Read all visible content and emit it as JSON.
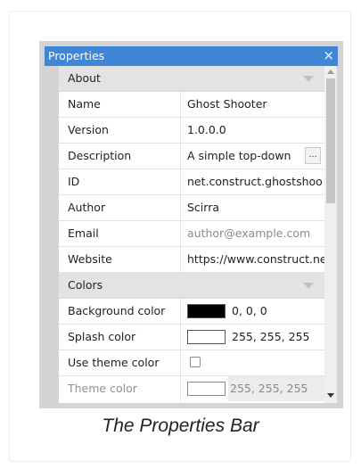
{
  "panel": {
    "title": "Properties",
    "close_icon": "×"
  },
  "sections": {
    "about": "About",
    "colors": "Colors"
  },
  "rows": {
    "name": {
      "label": "Name",
      "value": "Ghost Shooter"
    },
    "version": {
      "label": "Version",
      "value": "1.0.0.0"
    },
    "description": {
      "label": "Description",
      "value": "A simple top-down",
      "button": "..."
    },
    "id": {
      "label": "ID",
      "value": "net.construct.ghostshoo"
    },
    "author": {
      "label": "Author",
      "value": "Scirra"
    },
    "email": {
      "label": "Email",
      "placeholder": "author@example.com"
    },
    "website": {
      "label": "Website",
      "value": "https://www.construct.ne"
    },
    "background_color": {
      "label": "Background color",
      "value": "0, 0, 0",
      "swatch": "#000000"
    },
    "splash_color": {
      "label": "Splash color",
      "value": "255, 255, 255",
      "swatch": "#ffffff"
    },
    "use_theme_color": {
      "label": "Use theme color",
      "checked": false
    },
    "theme_color": {
      "label": "Theme color",
      "value": "255, 255, 255",
      "swatch": "#ffffff"
    }
  },
  "caption": "The Properties Bar",
  "colors": {
    "titlebar": "#3f87d6",
    "section_bg": "#e3e3e3"
  }
}
